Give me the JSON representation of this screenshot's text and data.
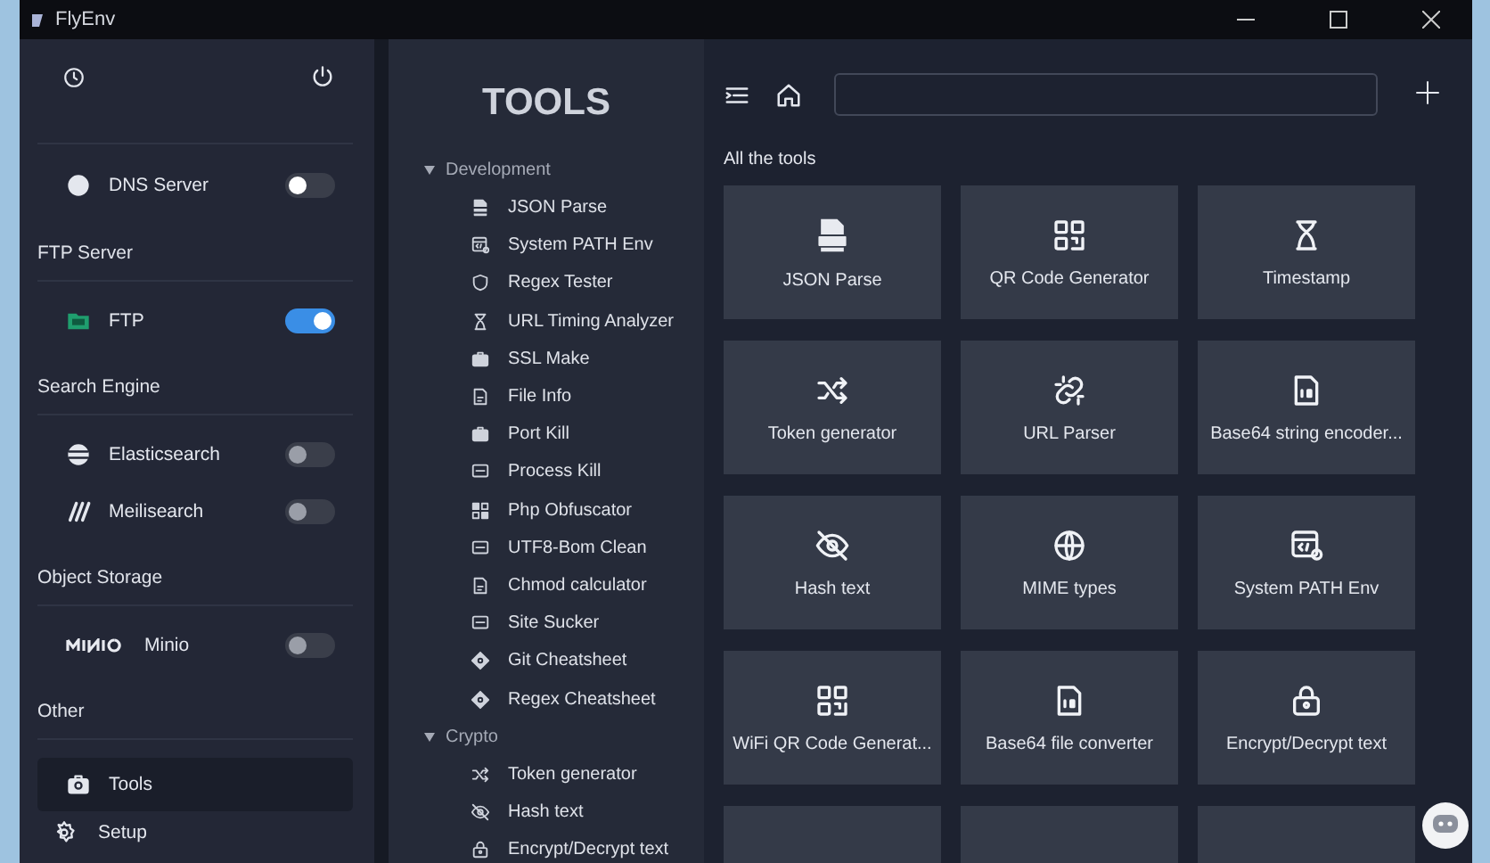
{
  "window": {
    "title": "FlyEnv"
  },
  "sidebar": {
    "groups": [
      {
        "items": [
          {
            "label": "DNS Server",
            "on": false
          }
        ]
      },
      {
        "header": "FTP Server",
        "items": [
          {
            "label": "FTP",
            "on": true
          }
        ]
      },
      {
        "header": "Search Engine",
        "items": [
          {
            "label": "Elasticsearch",
            "on": false
          },
          {
            "label": "Meilisearch",
            "on": false
          }
        ]
      },
      {
        "header": "Object Storage",
        "items": [
          {
            "label": "Minio",
            "on": false
          }
        ]
      },
      {
        "header": "Other",
        "items": [
          {
            "label": "Tools",
            "selected": true
          }
        ]
      }
    ],
    "footer": [
      {
        "label": "Setup"
      }
    ]
  },
  "tools_panel": {
    "title": "TOOLS",
    "tree": [
      {
        "label": "Development",
        "expanded": true,
        "children": [
          {
            "label": "JSON Parse"
          },
          {
            "label": "System PATH Env"
          },
          {
            "label": "Regex Tester"
          },
          {
            "label": "URL Timing Analyzer"
          },
          {
            "label": "SSL Make"
          },
          {
            "label": "File Info"
          },
          {
            "label": "Port Kill"
          },
          {
            "label": "Process Kill"
          },
          {
            "label": "Php Obfuscator"
          },
          {
            "label": "UTF8-Bom Clean"
          },
          {
            "label": "Chmod calculator"
          },
          {
            "label": "Site Sucker"
          },
          {
            "label": "Git Cheatsheet"
          },
          {
            "label": "Regex Cheatsheet"
          }
        ]
      },
      {
        "label": "Crypto",
        "expanded": true,
        "children": [
          {
            "label": "Token generator"
          },
          {
            "label": "Hash text"
          },
          {
            "label": "Encrypt/Decrypt text"
          }
        ]
      }
    ]
  },
  "content": {
    "section_title": "All the tools",
    "cards": [
      {
        "label": "JSON Parse"
      },
      {
        "label": "QR Code Generator"
      },
      {
        "label": "Timestamp"
      },
      {
        "label": "Token generator"
      },
      {
        "label": "URL Parser"
      },
      {
        "label": "Base64 string encoder..."
      },
      {
        "label": "Hash text"
      },
      {
        "label": "MIME types"
      },
      {
        "label": "System PATH Env"
      },
      {
        "label": "WiFi QR Code Generat..."
      },
      {
        "label": "Base64 file converter"
      },
      {
        "label": "Encrypt/Decrypt text"
      }
    ]
  }
}
